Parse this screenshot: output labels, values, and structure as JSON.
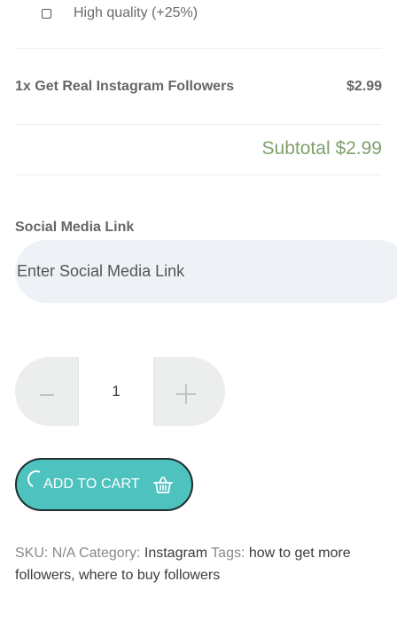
{
  "option": {
    "label": "High quality (+25%)",
    "checked": false
  },
  "order_summary": {
    "item": "1x Get Real Instagram Followers",
    "price": "$2.99",
    "subtotal": "Subtotal $2.99"
  },
  "social_link": {
    "label": "Social Media Link",
    "placeholder": "Enter Social Media Link"
  },
  "quantity": {
    "minus": "–",
    "value": "1",
    "plus": "+"
  },
  "cart_button": {
    "label": "ADD TO CART",
    "icon": "basket-icon"
  },
  "meta": {
    "sku_label": "SKU:",
    "sku_value": "N/A",
    "category_label": "Category:",
    "category_value": "Instagram",
    "tags_label": "Tags:",
    "tags_value": "how to get more followers, where to buy followers"
  },
  "colors": {
    "accent": "#4ec2bf",
    "subtotal": "#7fa06e",
    "input_bg": "#eef2f6",
    "qty_bg": "#eceeee"
  }
}
